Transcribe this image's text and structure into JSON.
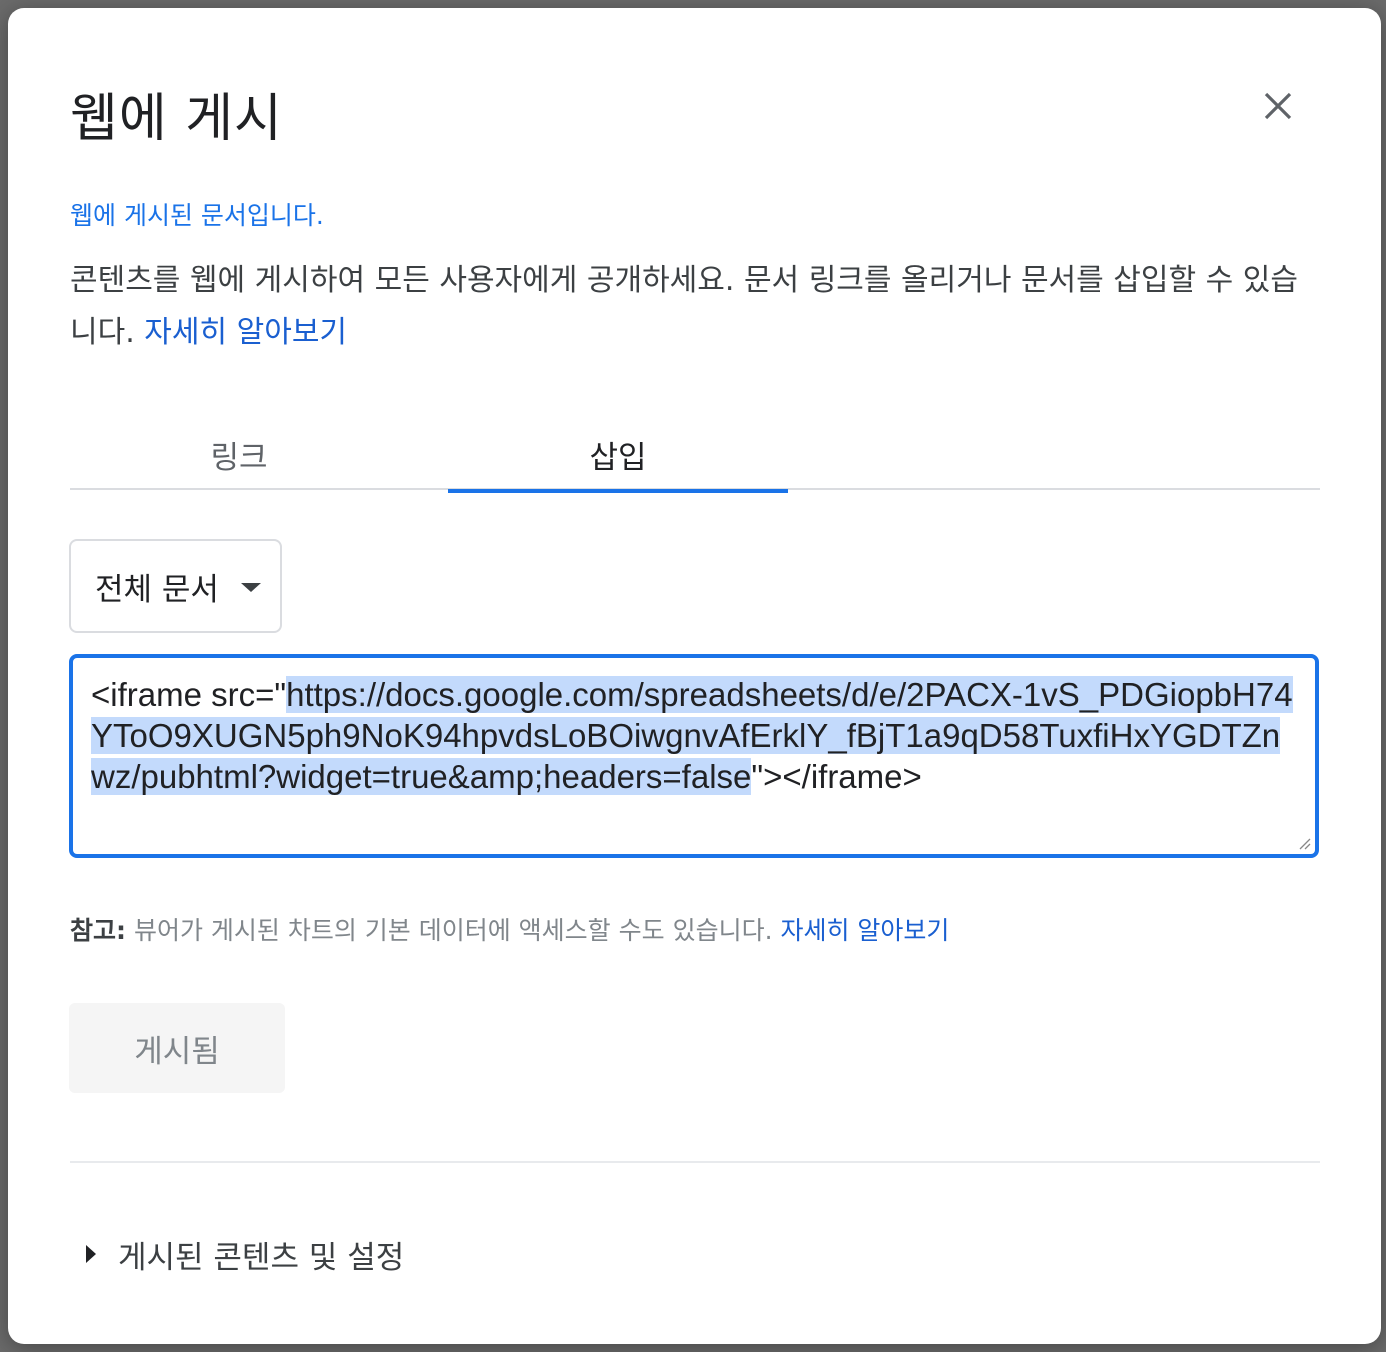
{
  "dialog": {
    "title": "웹에 게시",
    "status": "웹에 게시된 문서입니다.",
    "description": "콘텐츠를 웹에 게시하여 모든 사용자에게 공개하세요. 문서 링크를 올리거나 문서를 삽입할 수 있습니다. ",
    "learn_more": "자세히 알아보기"
  },
  "tabs": [
    {
      "label": "링크",
      "active": false
    },
    {
      "label": "삽입",
      "active": true
    }
  ],
  "scope_select": {
    "value": "전체 문서"
  },
  "embed": {
    "prefix": "<iframe src=\"",
    "url": "https://docs.google.com/spreadsheets/d/e/2PACX-1vS_PDGiopbH74YToO9XUGN5ph9NoK94hpvdsLoBOiwgnvAfErklY_fBjT1a9qD58TuxfiHxYGDTZnwz/pubhtml?widget=true&amp;headers=false",
    "suffix": "\"></iframe>"
  },
  "note": {
    "prefix": "참고:",
    "text": " 뷰어가 게시된 차트의 기본 데이터에 액세스할 수도 있습니다. ",
    "learn_more": "자세히 알아보기"
  },
  "published_button": {
    "label": "게시됨"
  },
  "expander": {
    "label": "게시된 콘텐츠 및 설정"
  },
  "colors": {
    "accent": "#1a73e8",
    "link": "#1a5fd0",
    "selection": "#c3dafc"
  },
  "icons": {
    "close": "close-icon",
    "dropdown": "chevron-down-icon",
    "expand": "triangle-right-icon"
  }
}
